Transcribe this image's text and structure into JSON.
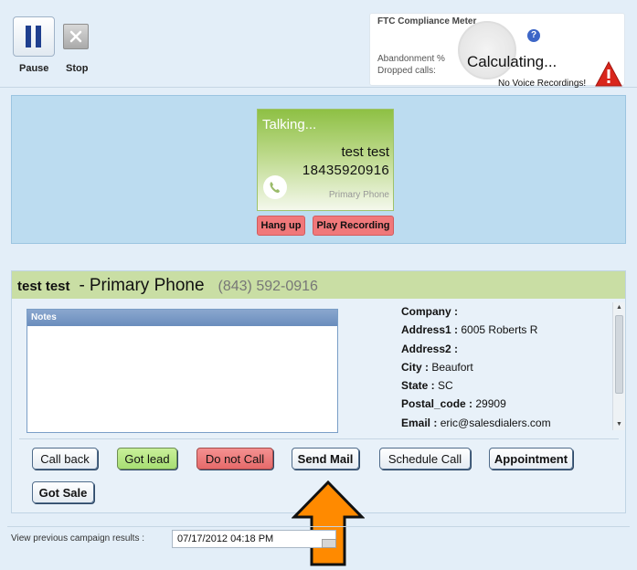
{
  "toolbar": {
    "pause_label": "Pause",
    "stop_label": "Stop",
    "pause_icon": "pause-icon",
    "stop_icon": "close-icon"
  },
  "ftc": {
    "title": "FTC Compliance Meter",
    "help_glyph": "?",
    "abandonment_label": "Abandonment %",
    "dropped_label": "Dropped calls:",
    "status": "Calculating...",
    "voice_warning": "No Voice Recordings!"
  },
  "call": {
    "status": "Talking...",
    "name": "test test",
    "number": "18435920916",
    "phone_type": "Primary Phone",
    "hangup_label": "Hang up",
    "play_label": "Play Recording"
  },
  "contact": {
    "name": "test test",
    "separator": "-",
    "phone_type": "Primary Phone",
    "phone": "(843) 592-0916",
    "notes_label": "Notes",
    "notes_value": "",
    "fields": [
      {
        "label": "Company :",
        "value": ""
      },
      {
        "label": "Address1 :",
        "value": "6005 Roberts R"
      },
      {
        "label": "Address2 :",
        "value": ""
      },
      {
        "label": "City :",
        "value": "Beaufort"
      },
      {
        "label": "State :",
        "value": "SC"
      },
      {
        "label": "Postal_code :",
        "value": "29909"
      },
      {
        "label": "Email :",
        "value": "eric@salesdialers.com"
      }
    ]
  },
  "actions": {
    "call_back": "Call back",
    "got_lead": "Got lead",
    "do_not_call": "Do not Call",
    "send_mail": "Send Mail",
    "schedule_call": "Schedule Call",
    "appointment": "Appointment",
    "got_sale": "Got Sale"
  },
  "footer": {
    "label": "View previous campaign results :",
    "date_value": "07/17/2012 04:18 PM"
  },
  "colors": {
    "page_bg": "#e3eef8",
    "call_panel": "#bcdcf0",
    "contact_header": "#c9dea4",
    "danger": "#f0787a",
    "success": "#a7de73",
    "arrow": "#ff8a00"
  }
}
